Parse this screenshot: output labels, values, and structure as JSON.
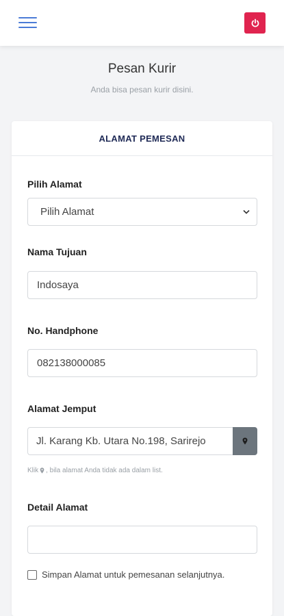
{
  "header": {
    "menu_icon": "hamburger-menu-icon",
    "logout_icon": "power-icon",
    "logout_color": "#e0244f"
  },
  "page": {
    "title": "Pesan Kurir",
    "subtitle": "Anda bisa pesan kurir disini."
  },
  "card": {
    "header": "ALAMAT PEMESAN",
    "pilih_alamat": {
      "label": "Pilih Alamat",
      "selected": "Pilih Alamat"
    },
    "nama_tujuan": {
      "label": "Nama Tujuan",
      "value": "Indosaya"
    },
    "no_handphone": {
      "label": "No. Handphone",
      "value": "082138000085"
    },
    "alamat_jemput": {
      "label": "Alamat Jemput",
      "value": "Jl. Karang Kb. Utara No.198, Sarirejo",
      "hint_prefix": "Klik",
      "hint_suffix": ", bila alamat Anda tidak ada dalam list."
    },
    "detail_alamat": {
      "label": "Detail Alamat",
      "value": ""
    },
    "simpan_alamat": {
      "label": "Simpan Alamat untuk pemesanan selanjutnya.",
      "checked": false
    }
  }
}
